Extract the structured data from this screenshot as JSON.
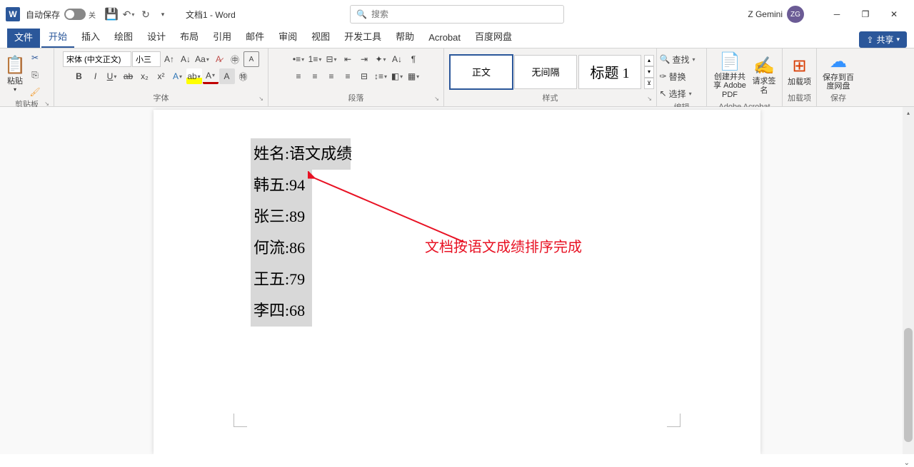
{
  "titlebar": {
    "autosave": "自动保存",
    "autosave_state": "关",
    "doc_title": "文档1 - Word",
    "search_placeholder": "搜索",
    "user_name": "Z Gemini",
    "user_initials": "ZG"
  },
  "tabs": {
    "file": "文件",
    "home": "开始",
    "insert": "插入",
    "draw": "绘图",
    "design": "设计",
    "layout": "布局",
    "references": "引用",
    "mailings": "邮件",
    "review": "审阅",
    "view": "视图",
    "devtools": "开发工具",
    "help": "帮助",
    "acrobat": "Acrobat",
    "baidu": "百度网盘",
    "share": "共享"
  },
  "ribbon": {
    "clipboard": {
      "label": "剪贴板",
      "paste": "粘贴"
    },
    "font": {
      "label": "字体",
      "name": "宋体 (中文正文)",
      "size": "小三"
    },
    "paragraph": {
      "label": "段落"
    },
    "styles": {
      "label": "样式",
      "normal": "正文",
      "no_spacing": "无间隔",
      "heading1": "标题 1"
    },
    "editing": {
      "label": "编辑",
      "find": "查找",
      "replace": "替换",
      "select": "选择"
    },
    "acrobat": {
      "label": "Adobe Acrobat",
      "create": "创建并共享 Adobe PDF",
      "signature": "请求签名"
    },
    "addins": {
      "label": "加载项",
      "addins_btn": "加载项"
    },
    "save": {
      "label": "保存",
      "save_btn": "保存到百度网盘"
    }
  },
  "document": {
    "header_line": "姓名:语文成绩",
    "rows": [
      "韩五:94",
      "张三:89",
      "何流:86",
      "王五:79",
      "李四:68"
    ],
    "annotation": "文档按语文成绩排序完成"
  }
}
